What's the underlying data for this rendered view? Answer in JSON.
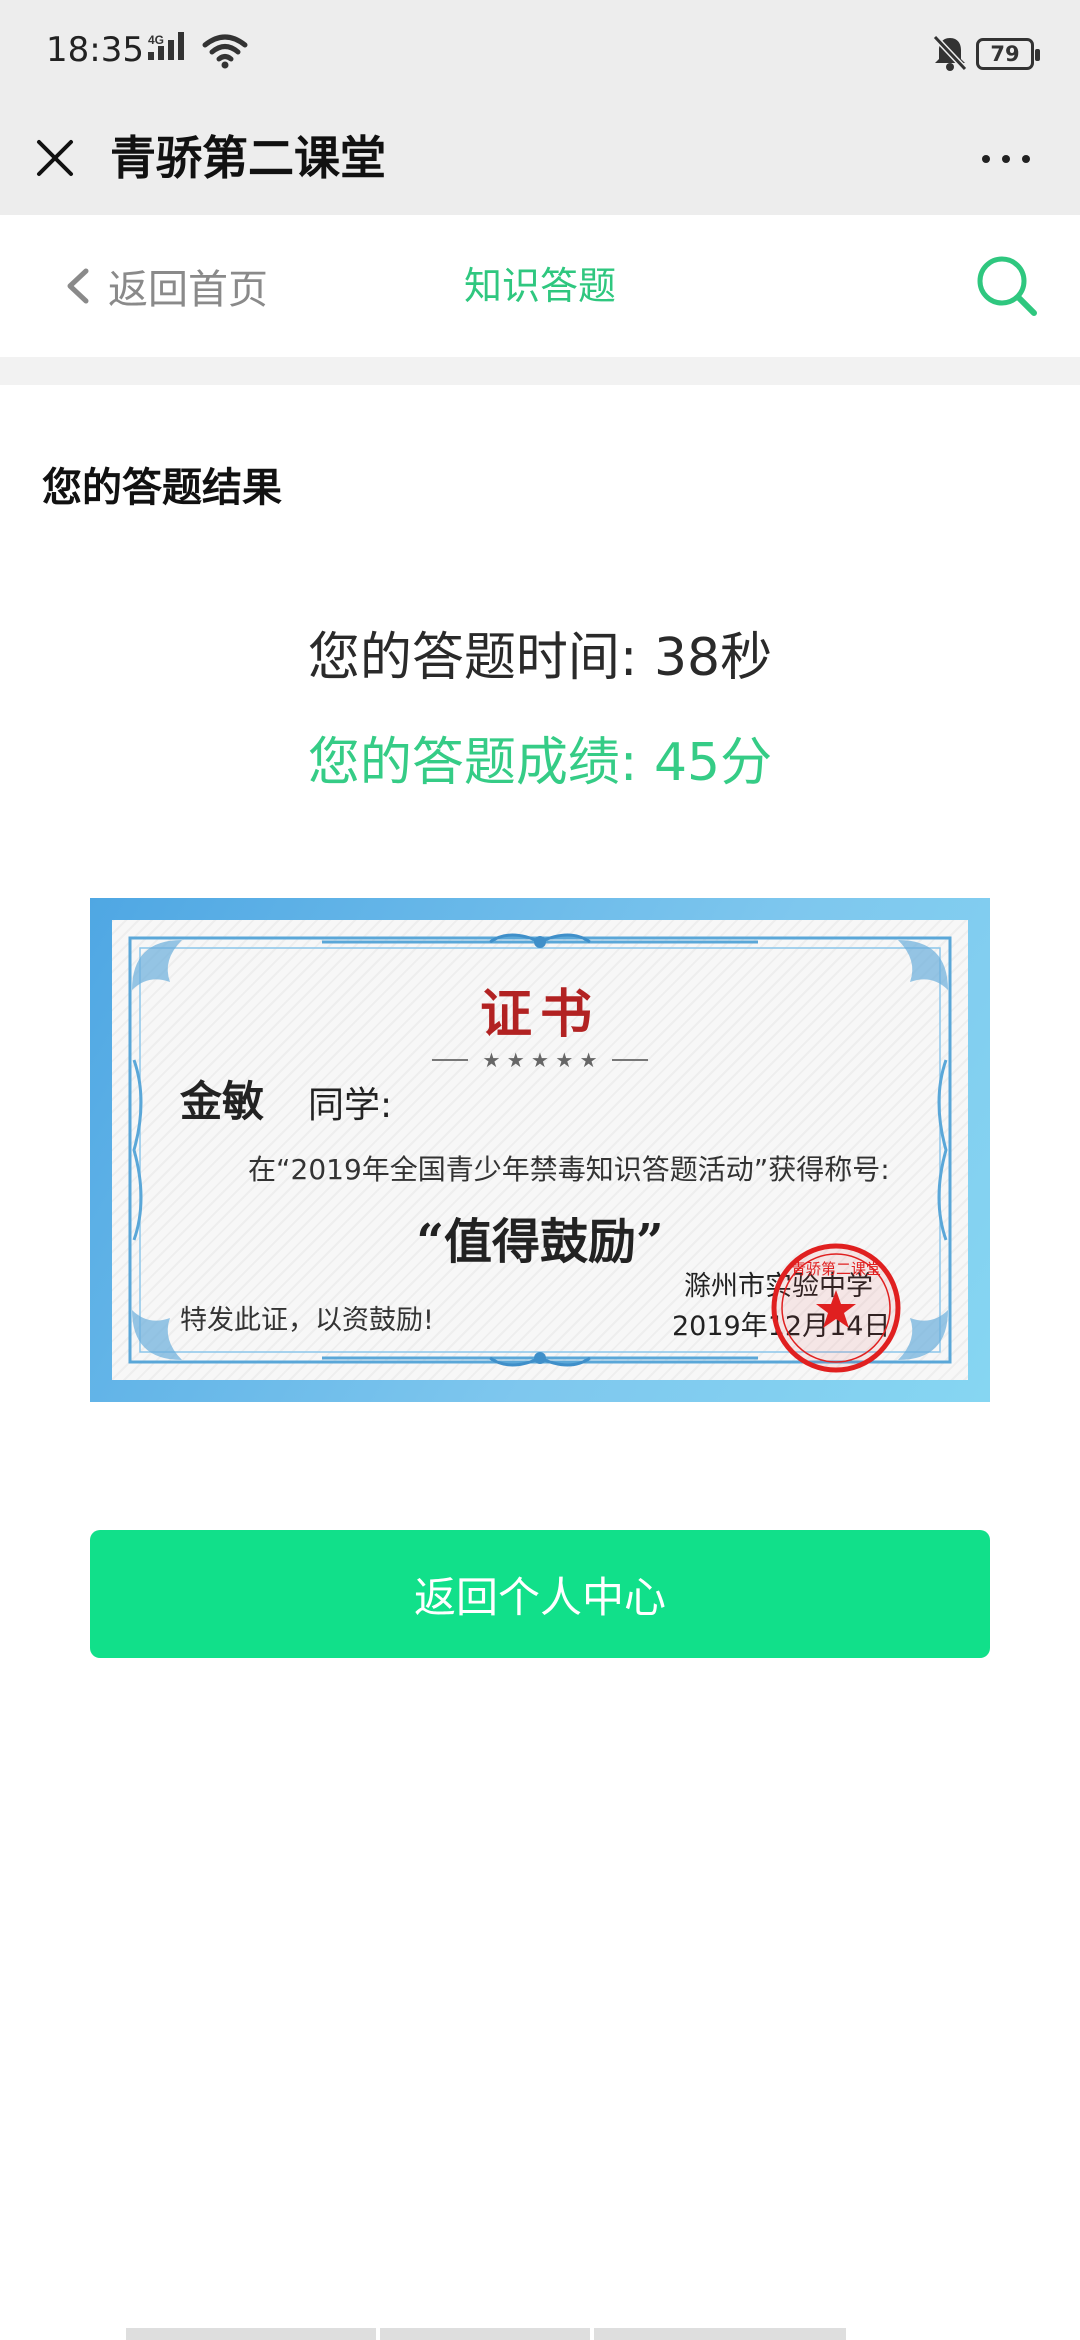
{
  "status_bar": {
    "time": "18:35",
    "network": "4G",
    "battery": "79"
  },
  "title_bar": {
    "title": "青骄第二课堂"
  },
  "page_nav": {
    "back_label": "返回首页",
    "title": "知识答题"
  },
  "result": {
    "heading": "您的答题结果",
    "time_text": "您的答题时间: 38秒",
    "score_text": "您的答题成绩: 45分"
  },
  "certificate": {
    "title": "证书",
    "student_name": "金敏",
    "greeting": "同学:",
    "line1": "在“2019年全国青少年禁毒知识答题活动”获得称号:",
    "award": "“值得鼓励”",
    "closing": "特发此证，以资鼓励!",
    "issuer": "滁州市实验中学",
    "date": "2019年12月14日",
    "seal_text": "青骄第二课堂"
  },
  "action": {
    "button_label": "返回个人中心"
  },
  "colors": {
    "accent_green": "#2fc77f",
    "button_green": "#11e08a",
    "seal_red": "#e02020",
    "cert_title_red": "#b22222"
  },
  "icons": [
    "close-icon",
    "more-icon",
    "chevron-left-icon",
    "search-icon",
    "signal-icon",
    "wifi-icon",
    "mute-icon",
    "battery-icon"
  ]
}
